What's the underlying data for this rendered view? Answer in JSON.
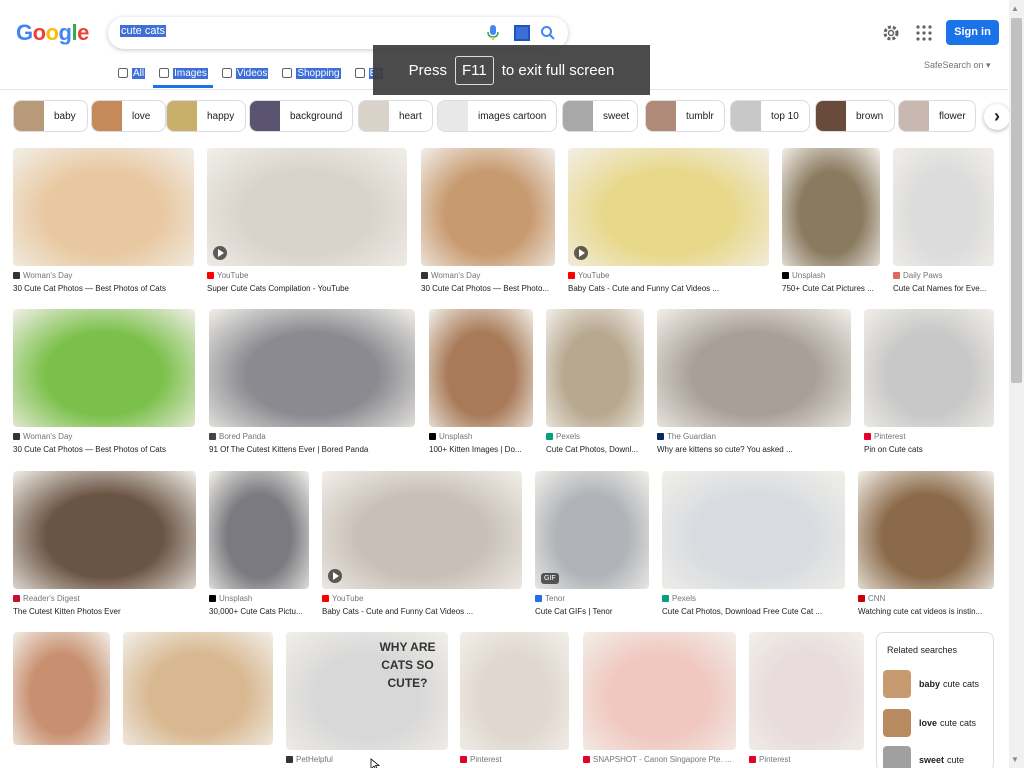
{
  "header": {
    "logo_letters": [
      "G",
      "o",
      "o",
      "g",
      "l",
      "e"
    ],
    "logo_colors": [
      "#4285f4",
      "#ea4335",
      "#fbbc05",
      "#4285f4",
      "#34a853",
      "#ea4335"
    ],
    "search_value": "cute cats",
    "sign_in_label": "Sign in",
    "safesearch_label": "SafeSearch on ▾"
  },
  "tabs": [
    {
      "label": "All",
      "icon": "search-icon"
    },
    {
      "label": "Images",
      "icon": "image-icon",
      "active": true
    },
    {
      "label": "Videos",
      "icon": "video-icon"
    },
    {
      "label": "Shopping",
      "icon": "tag-icon"
    },
    {
      "label": "Bo",
      "icon": "book-icon"
    }
  ],
  "toast": {
    "before": "Press",
    "key": "F11",
    "after": "to exit full screen"
  },
  "chips": [
    {
      "label": "baby",
      "color": "#b89a7a"
    },
    {
      "label": "love",
      "color": "#c48a5a"
    },
    {
      "label": "happy",
      "color": "#c9b06a"
    },
    {
      "label": "background",
      "color": "#5a5470"
    },
    {
      "label": "heart",
      "color": "#d8d2c8"
    },
    {
      "label": "images cartoon",
      "color": "#e8e8e8"
    },
    {
      "label": "sweet",
      "color": "#a8a8a8"
    },
    {
      "label": "tumblr",
      "color": "#b08a78"
    },
    {
      "label": "top 10",
      "color": "#c8c8c8"
    },
    {
      "label": "brown",
      "color": "#6a4a3a"
    },
    {
      "label": "flower",
      "color": "#c8b8b0"
    }
  ],
  "chips_next_label": "›",
  "results": [
    {
      "source": "Woman's Day",
      "title": "30 Cute Cat Photos — Best Photos of Cats",
      "fav": "#333",
      "color": "#e8c8a0"
    },
    {
      "source": "YouTube",
      "title": "Super Cute Cats Compilation - YouTube",
      "fav": "#ff0000",
      "color": "#d8d4cc",
      "video": true
    },
    {
      "source": "Woman's Day",
      "title": "30 Cute Cat Photos — Best Photo...",
      "fav": "#333",
      "color": "#c89a70"
    },
    {
      "source": "YouTube",
      "title": "Baby Cats - Cute and Funny Cat Videos ...",
      "fav": "#ff0000",
      "color": "#e8d88a",
      "video": true
    },
    {
      "source": "Unsplash",
      "title": "750+ Cute Cat Pictures ...",
      "fav": "#000",
      "color": "#8a7a60"
    },
    {
      "source": "Daily Paws",
      "title": "Cute Cat Names for Eve...",
      "fav": "#e06a5a",
      "color": "#dcdcdc"
    },
    {
      "source": "Woman's Day",
      "title": "30 Cute Cat Photos — Best Photos of Cats",
      "fav": "#333",
      "color": "#7ac04a"
    },
    {
      "source": "Bored Panda",
      "title": "91 Of The Cutest Kittens Ever | Bored Panda",
      "fav": "#444",
      "color": "#8a8a90"
    },
    {
      "source": "Unsplash",
      "title": "100+ Kitten Images | Do...",
      "fav": "#000",
      "color": "#a87a58"
    },
    {
      "source": "Pexels",
      "title": "Cute Cat Photos, Downl...",
      "fav": "#05a081",
      "color": "#b8a890"
    },
    {
      "source": "The Guardian",
      "title": "Why are kittens so cute? You asked ...",
      "fav": "#052962",
      "color": "#a8a098"
    },
    {
      "source": "Pinterest",
      "title": "Pin on Cute cats",
      "fav": "#e60023",
      "color": "#c8c8c8"
    },
    {
      "source": "Reader's Digest",
      "title": "The Cutest Kitten Photos Ever",
      "fav": "#c8102e",
      "color": "#6a5444"
    },
    {
      "source": "Unsplash",
      "title": "30,000+ Cute Cats Pictu...",
      "fav": "#000",
      "color": "#7a7a80"
    },
    {
      "source": "YouTube",
      "title": "Baby Cats - Cute and Funny Cat Videos ...",
      "fav": "#ff0000",
      "color": "#c8c0b8",
      "video": true
    },
    {
      "source": "Tenor",
      "title": "Cute Cat GIFs | Tenor",
      "fav": "#1f6feb",
      "color": "#b0b4b8",
      "gif": true
    },
    {
      "source": "Pexels",
      "title": "Cute Cat Photos, Download Free Cute Cat ...",
      "fav": "#05a081",
      "color": "#d8dce0"
    },
    {
      "source": "CNN",
      "title": "Watching cute cat videos is instin...",
      "fav": "#cc0000",
      "color": "#8a6a4a"
    },
    {
      "source": "",
      "title": "",
      "fav": "#fff",
      "color": "#c89070"
    },
    {
      "source": "",
      "title": "",
      "fav": "#fff",
      "color": "#d8b890"
    },
    {
      "source": "PetHelpful",
      "title": "",
      "fav": "#333",
      "color": "#d8d8d8",
      "overlay_text": "WHY ARE CATS SO CUTE?"
    },
    {
      "source": "Pinterest",
      "title": "",
      "fav": "#e60023",
      "color": "#e0d8d0"
    },
    {
      "source": "SNAPSHOT - Canon Singapore Pte. ...",
      "title": "",
      "fav": "#e60023",
      "color": "#f0c8c0"
    },
    {
      "source": "Pinterest",
      "title": "",
      "fav": "#e60023",
      "color": "#e8dcdc"
    }
  ],
  "related": {
    "title": "Related searches",
    "items": [
      {
        "bold": "baby",
        "rest": "cute cats",
        "color": "#c89a70"
      },
      {
        "bold": "love",
        "rest": "cute cats",
        "color": "#b88a60"
      },
      {
        "bold": "sweet",
        "rest": "cute",
        "color": "#a0a0a0"
      }
    ]
  }
}
